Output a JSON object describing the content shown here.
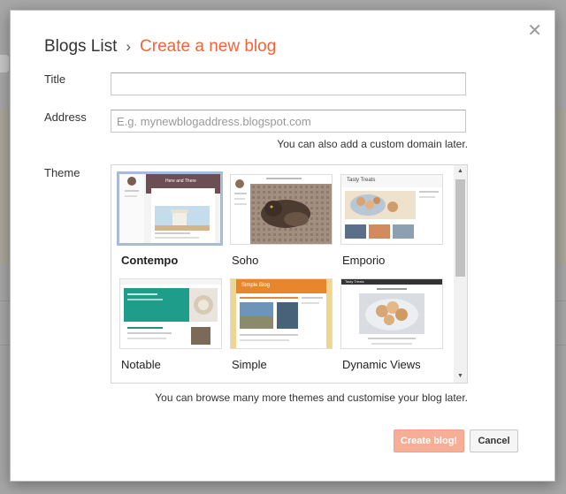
{
  "dialog": {
    "breadcrumb_root": "Blogs List",
    "breadcrumb_separator": "›",
    "title": "Create a new blog",
    "close_glyph": "✕"
  },
  "form": {
    "title_label": "Title",
    "title_value": "",
    "address_label": "Address",
    "address_placeholder": "E.g. mynewblogaddress.blogspot.com",
    "address_hint": "You can also add a custom domain later.",
    "theme_label": "Theme",
    "theme_hint": "You can browse many more themes and customise your blog later.",
    "selected_theme": "Contempo"
  },
  "themes": [
    {
      "name": "Contempo",
      "thumb_text": "Here and There"
    },
    {
      "name": "Soho",
      "thumb_text": ""
    },
    {
      "name": "Emporio",
      "thumb_text": "Tasty Treats"
    },
    {
      "name": "Notable",
      "thumb_text": ""
    },
    {
      "name": "Simple",
      "thumb_text": "Simple Blog"
    },
    {
      "name": "Dynamic Views",
      "thumb_text": "Tasty Treats"
    }
  ],
  "buttons": {
    "create": "Create blog!",
    "cancel": "Cancel"
  },
  "colors": {
    "accent": "#f0663a",
    "create_button": "#f6ae96",
    "selected_border": "#a8bbd8"
  }
}
